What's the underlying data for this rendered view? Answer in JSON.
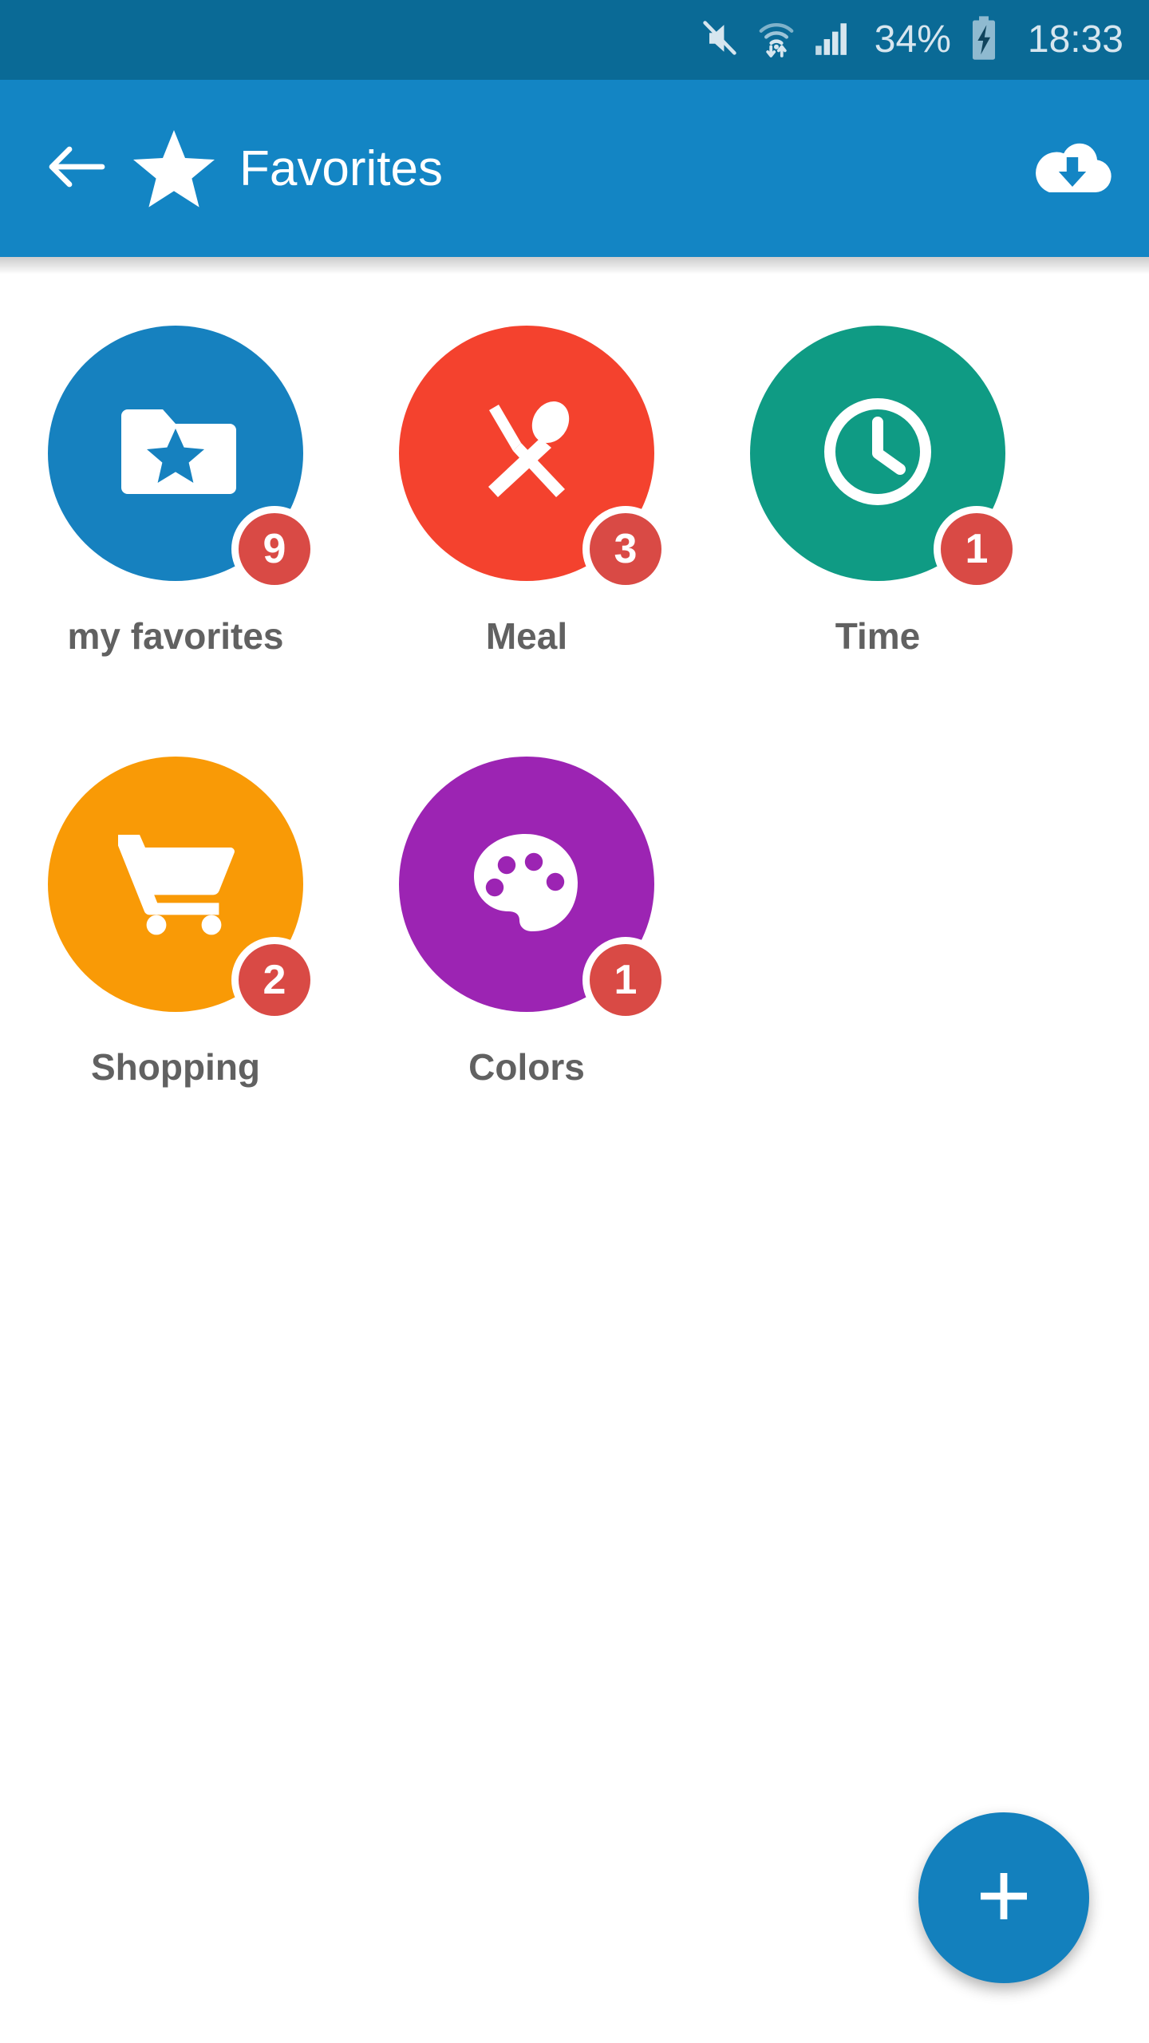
{
  "status_bar": {
    "background": "#0a6a96",
    "icons": [
      "mute-icon",
      "wifi-transfer-icon",
      "cellular-signal-icon"
    ],
    "battery_percent": "34%",
    "battery_state": "charging",
    "time": "18:33",
    "text_color": "#d7e6ef"
  },
  "app_bar": {
    "background": "#1385c4",
    "back_icon": "back-arrow-icon",
    "leading_icon": "star-icon",
    "title": "Favorites",
    "action_icon": "cloud-download-icon",
    "title_color": "#ffffff"
  },
  "grid": {
    "items": [
      {
        "label": "my favorites",
        "icon": "folder-star-icon",
        "color": "#1681bf",
        "badge": "9",
        "badge_color": "#d94a45"
      },
      {
        "label": "Meal",
        "icon": "cutlery-icon",
        "color": "#f4422e",
        "badge": "3",
        "badge_color": "#d94a45"
      },
      {
        "label": "Time",
        "icon": "clock-icon",
        "color": "#0f9b84",
        "badge": "1",
        "badge_color": "#d94a45"
      },
      {
        "label": "Shopping",
        "icon": "shopping-cart-icon",
        "color": "#f99a06",
        "badge": "2",
        "badge_color": "#d94a45"
      },
      {
        "label": "Colors",
        "icon": "palette-icon",
        "color": "#9c24b3",
        "badge": "1",
        "badge_color": "#d94a45"
      }
    ],
    "label_color": "#616161"
  },
  "fab": {
    "icon": "plus-icon",
    "color": "#1380bd",
    "label": "add"
  }
}
